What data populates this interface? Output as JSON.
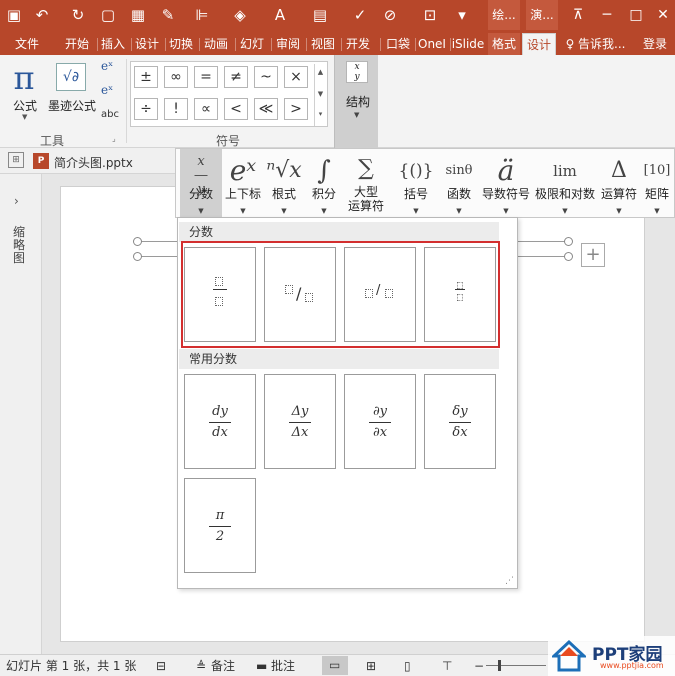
{
  "title_bar": {
    "contextual_tabs": [
      "绘...",
      "演..."
    ]
  },
  "tabs": [
    "文件",
    "开始",
    "插入",
    "设计",
    "切换",
    "动画",
    "幻灯",
    "审阅",
    "视图",
    "开发",
    "口袋",
    "OneI",
    "iSlide",
    "格式",
    "设计"
  ],
  "tell_me": "告诉我...",
  "login": "登录",
  "ribbon": {
    "formula_label": "公式",
    "ink_formula_label": "墨迹公式",
    "abc_label": "abc",
    "tools_group": "工具",
    "symbols_group": "符号",
    "symbols_row1": [
      "±",
      "∞",
      "=",
      "≠",
      "~",
      "×"
    ],
    "symbols_row2": [
      "÷",
      "!",
      "∝",
      "<",
      "≪",
      ">"
    ],
    "structure_label": "结构"
  },
  "file_tab": "简介头图.pptx",
  "thumb_pane_label": "缩略图",
  "structures": [
    {
      "glyph": "x/y",
      "label": "分数",
      "label2": ""
    },
    {
      "glyph": "eˣ",
      "label": "上下标",
      "label2": ""
    },
    {
      "glyph": "ⁿ√x",
      "label": "根式",
      "label2": ""
    },
    {
      "glyph": "∫",
      "label": "积分",
      "label2": ""
    },
    {
      "glyph": "∑",
      "label": "大型",
      "label2": "运算符"
    },
    {
      "glyph": "{()}",
      "label": "括号",
      "label2": ""
    },
    {
      "glyph": "sinθ",
      "label": "函数",
      "label2": ""
    },
    {
      "glyph": "ä",
      "label": "导数符号",
      "label2": ""
    },
    {
      "glyph": "lim",
      "label": "极限和对数",
      "label2": ""
    },
    {
      "glyph": "Δ",
      "label": "运算符",
      "label2": ""
    },
    {
      "glyph": "[10]",
      "label": "矩阵",
      "label2": ""
    }
  ],
  "fraction_panel": {
    "section1": "分数",
    "section2": "常用分数",
    "common": [
      {
        "num": "dy",
        "den": "dx"
      },
      {
        "num": "Δy",
        "den": "Δx"
      },
      {
        "num": "∂y",
        "den": "∂x"
      },
      {
        "num": "δy",
        "den": "δx"
      },
      {
        "num": "π",
        "den": "2"
      }
    ]
  },
  "status": {
    "slide_info": "幻灯片 第 1 张，共 1 张",
    "notes": "备注",
    "comments": "批注"
  },
  "watermark": {
    "brand": "PPT家园",
    "url": "www.pptjia.com"
  },
  "colors": {
    "accent": "#b7472a",
    "highlight": "#d32f2f"
  }
}
